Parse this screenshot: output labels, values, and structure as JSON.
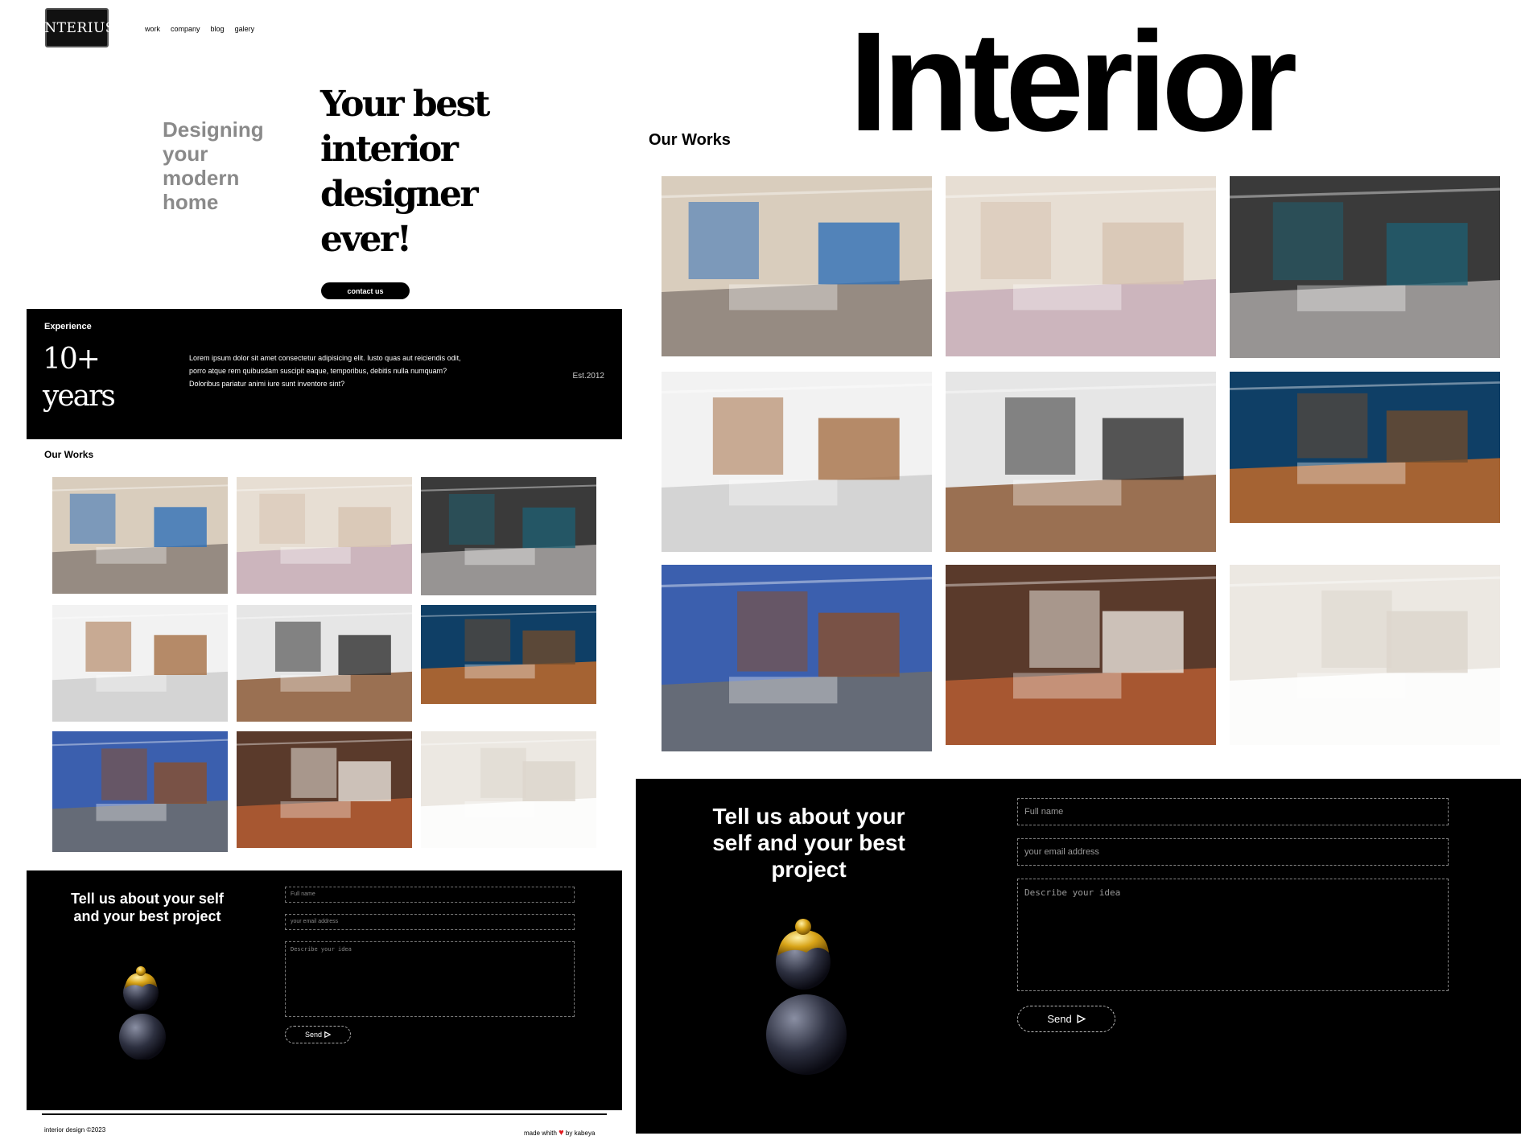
{
  "brand": {
    "logo_text": "INTERIUS"
  },
  "nav": [
    "work",
    "company",
    "blog",
    "galery"
  ],
  "hero": {
    "tagline": "Designing your modern home",
    "title": "Your best interior designer ever!",
    "cta_label": "contact us"
  },
  "experience": {
    "label": "Experience",
    "number": "10+ years",
    "text": "Lorem ipsum dolor sit amet consectetur adipisicing elit. Iusto quas aut reiciendis odit, porro atque rem quibusdam suscipit eaque, temporibus, debitis nulla numquam? Doloribus pariatur animi iure sunt inventore sint?",
    "established": "Est.2012"
  },
  "works": {
    "title": "Our Works",
    "photos": [
      {
        "icon": "living-room-photo",
        "colors": [
          "#d9cdbd",
          "#2f70b8",
          "#8a7f78"
        ]
      },
      {
        "icon": "dining-room-photo",
        "colors": [
          "#e7ded3",
          "#d7c3b1",
          "#c7aeb8"
        ]
      },
      {
        "icon": "lounge-photo",
        "colors": [
          "#3a3a3a",
          "#1f5e70",
          "#a8a5a3"
        ]
      },
      {
        "icon": "kitchen-photo",
        "colors": [
          "#f2f2f2",
          "#a56f45",
          "#cfcfcf"
        ]
      },
      {
        "icon": "modern-kitchen-photo",
        "colors": [
          "#e6e6e6",
          "#303030",
          "#8c5a37"
        ]
      },
      {
        "icon": "library-room-photo",
        "colors": [
          "#0f3f66",
          "#6e4b2d",
          "#c06a2a"
        ]
      },
      {
        "icon": "home-office-photo",
        "colors": [
          "#3b5fae",
          "#8a4f2c",
          "#6d6d6d"
        ]
      },
      {
        "icon": "restaurant-photo",
        "colors": [
          "#5a3a2b",
          "#e9e3dc",
          "#b55d33"
        ]
      },
      {
        "icon": "bathroom-photo",
        "colors": [
          "#ece8e2",
          "#dcd5cc",
          "#ffffff"
        ]
      }
    ]
  },
  "big_heading": "Interior",
  "contact_form": {
    "title": "Tell us about your self and your best project",
    "name_placeholder": "Full name",
    "email_placeholder": "your email address",
    "idea_placeholder": "Describe your idea",
    "send_label": "Send"
  },
  "footer": {
    "copyright": "interior design ©2023",
    "made_prefix": "made whith",
    "made_suffix": "by kabeya"
  }
}
